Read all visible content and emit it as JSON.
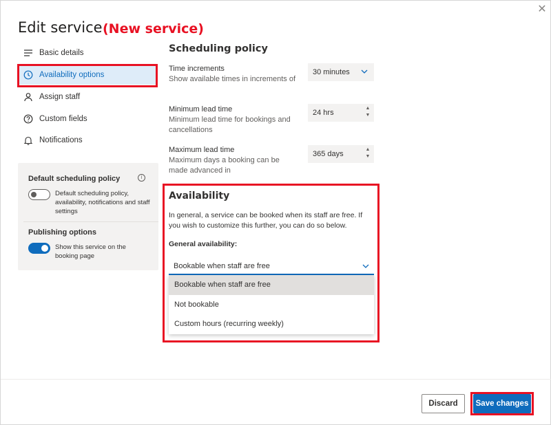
{
  "dialog": {
    "title": "Edit service",
    "annotation": "(New service)",
    "close_icon": "close-icon"
  },
  "nav": {
    "items": [
      {
        "label": "Basic details",
        "icon": "list-icon"
      },
      {
        "label": "Availability options",
        "icon": "clock-icon"
      },
      {
        "label": "Assign staff",
        "icon": "person-icon"
      },
      {
        "label": "Custom fields",
        "icon": "question-circle-icon"
      },
      {
        "label": "Notifications",
        "icon": "bell-icon"
      }
    ],
    "active_index": 1
  },
  "settings_card": {
    "default_policy": {
      "title": "Default scheduling policy",
      "info_icon": "i",
      "toggle_on": false,
      "toggle_text": "Default scheduling policy, availability, notifications and staff settings"
    },
    "publishing": {
      "title": "Publishing options",
      "toggle_on": true,
      "toggle_text": "Show this service on the booking page"
    }
  },
  "scheduling_policy": {
    "title": "Scheduling policy",
    "time_increments": {
      "label": "Time increments",
      "description": "Show available times in increments of",
      "value": "30 minutes"
    },
    "min_lead": {
      "label": "Minimum lead time",
      "description": "Minimum lead time for bookings and cancellations",
      "value": "24 hrs"
    },
    "max_lead": {
      "label": "Maximum lead time",
      "description": "Maximum days a booking can be made advanced in",
      "value": "365 days"
    }
  },
  "availability": {
    "title": "Availability",
    "description": "In general, a service can be booked when its staff are free. If you wish to customize this further, you can do so below.",
    "general_label": "General availability:",
    "selected": "Bookable when staff are free",
    "options": [
      "Bookable when staff are free",
      "Not bookable",
      "Custom hours (recurring weekly)"
    ],
    "selected_index": 0
  },
  "footer": {
    "discard": "Discard",
    "save": "Save changes"
  },
  "colors": {
    "accent": "#0f6cbd",
    "highlight": "#e81123"
  }
}
